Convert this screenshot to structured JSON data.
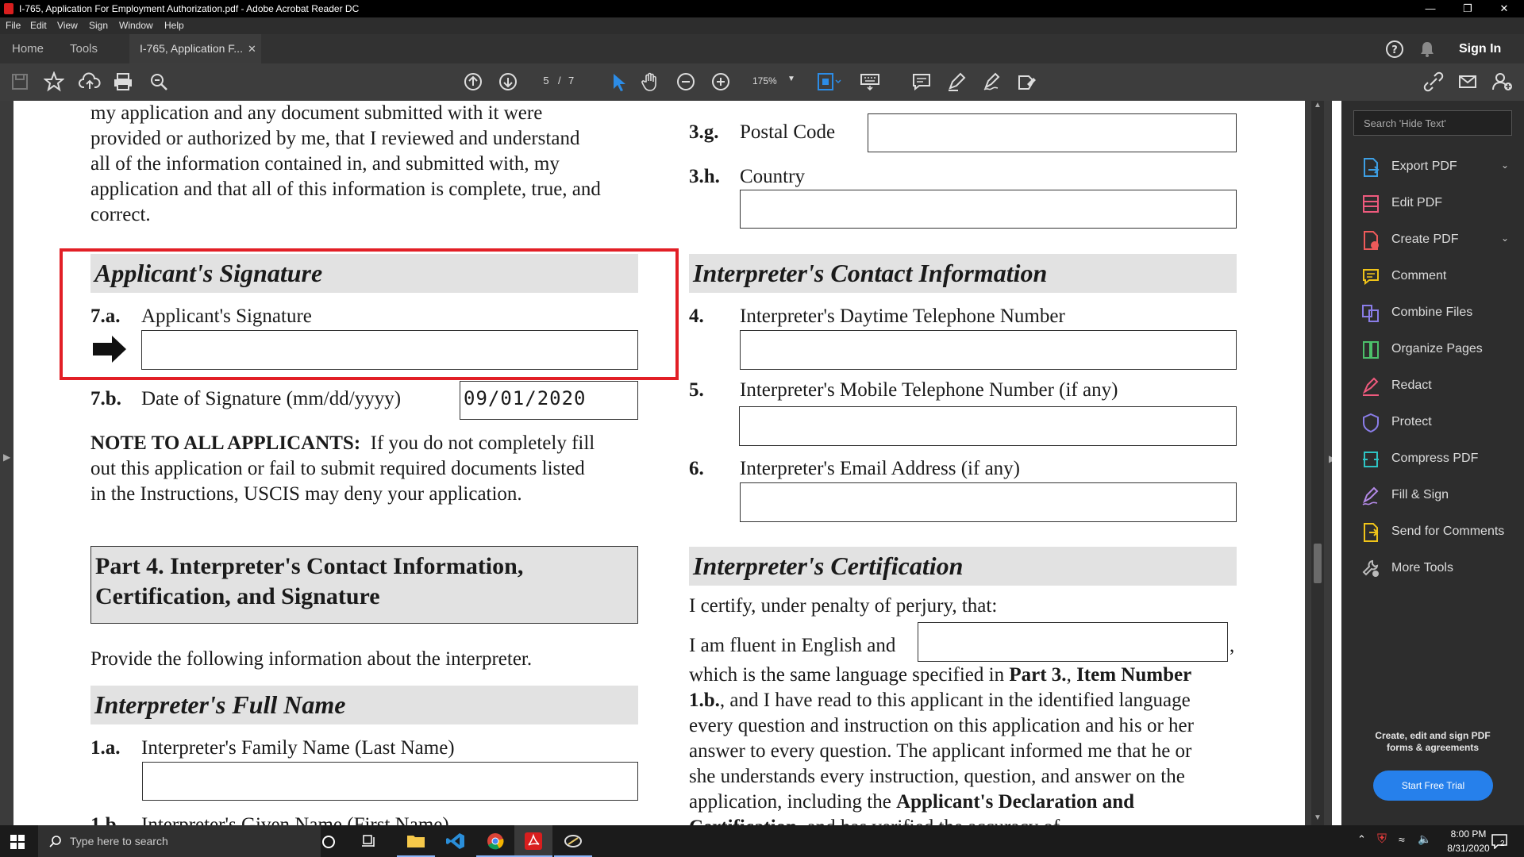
{
  "window": {
    "title": "I-765, Application For Employment Authorization.pdf - Adobe Acrobat Reader DC"
  },
  "menu": [
    "File",
    "Edit",
    "View",
    "Sign",
    "Window",
    "Help"
  ],
  "tabs": {
    "home": "Home",
    "tools": "Tools",
    "document": "I-765, Application F..."
  },
  "header_right": {
    "sign_in": "Sign In"
  },
  "toolbar": {
    "page_current": "5",
    "page_sep": "/",
    "page_total": "7",
    "zoom": "175%"
  },
  "document": {
    "left": {
      "para_lines": [
        "my application and any document submitted with it were",
        "provided or authorized by me, that I reviewed and understand",
        "all of the information contained in, and submitted with, my",
        "application and that all of this information is complete, true, and",
        "correct."
      ],
      "sig_header": "Applicant's Signature",
      "item_7a_num": "7.a.",
      "item_7a_label": "Applicant's Signature",
      "item_7b_num": "7.b.",
      "item_7b_label": "Date of Signature (mm/dd/yyyy)",
      "item_7b_value": "09/01/2020",
      "note_bold": "NOTE TO ALL APPLICANTS:",
      "note_line1": "If you do not completely fill",
      "note_line2": "out this application or fail to submit required documents listed",
      "note_line3": "in the Instructions, USCIS may deny your application.",
      "part4_line1": "Part 4.  Interpreter's Contact Information,",
      "part4_line2": "Certification, and Signature",
      "provide": "Provide the following information about the interpreter.",
      "full_name_header": "Interpreter's Full Name",
      "item_1a_num": "1.a.",
      "item_1a_label": "Interpreter's Family Name (Last Name)",
      "item_1b_num": "1.b.",
      "item_1b_label": "Interpreter's Given Name (First Name)"
    },
    "right": {
      "item_3g_num": "3.g.",
      "item_3g_label": "Postal Code",
      "item_3h_num": "3.h.",
      "item_3h_label": "Country",
      "contact_header": "Interpreter's Contact Information",
      "item_4_num": "4.",
      "item_4_label": "Interpreter's Daytime Telephone Number",
      "item_5_num": "5.",
      "item_5_label": "Interpreter's Mobile Telephone Number (if any)",
      "item_6_num": "6.",
      "item_6_label": "Interpreter's Email Address (if any)",
      "cert_header": "Interpreter's Certification",
      "cert_line1": "I certify, under penalty of perjury, that:",
      "cert_fluent": "I am fluent in English and",
      "cert_comma": ",",
      "cert_l3a": "which is the same language specified in",
      "cert_l3b": "Part 3.",
      "cert_l3c": ",",
      "cert_l3d": "Item Number",
      "cert_l4a": "1.b.",
      "cert_l4b": ", and I have read to this applicant in the identified language",
      "cert_l5": "every question and instruction on this application and his or her",
      "cert_l6": "answer to every question.  The applicant informed me that he or",
      "cert_l7": "she understands every instruction, question, and answer on the",
      "cert_l8a": "application, including the",
      "cert_l8b": "Applicant's Declaration and",
      "cert_l9a": "Certification",
      "cert_l9b": ", and has verified the accuracy of"
    }
  },
  "right_panel": {
    "search_placeholder": "Search 'Hide Text'",
    "items": [
      "Export PDF",
      "Edit PDF",
      "Create PDF",
      "Comment",
      "Combine Files",
      "Organize Pages",
      "Redact",
      "Protect",
      "Compress PDF",
      "Fill & Sign",
      "Send for Comments",
      "More Tools"
    ],
    "promo_line1": "Create, edit and sign PDF",
    "promo_line2": "forms & agreements",
    "trial_button": "Start Free Trial"
  },
  "taskbar": {
    "search_placeholder": "Type here to search",
    "time": "8:00 PM",
    "date": "8/31/2020",
    "notif_count": "2"
  }
}
